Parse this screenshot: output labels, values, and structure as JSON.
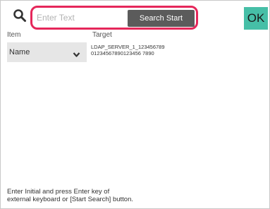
{
  "search": {
    "placeholder": "Enter Text",
    "value": "",
    "start_label": "Search Start"
  },
  "ok": {
    "label": "OK"
  },
  "columns": {
    "item": "Item",
    "target": "Target"
  },
  "item_select": {
    "selected": "Name"
  },
  "target": {
    "line1": "LDAP_SERVER_1_123456789",
    "line2": "01234567890123456 7890"
  },
  "hint": {
    "line1": "Enter Initial and press Enter key of",
    "line2": "external keyboard or [Start Search] button."
  },
  "colors": {
    "highlight": "#e5275a",
    "ok_button": "#46bfa7",
    "search_button": "#5b5b5b"
  },
  "icons": {
    "search": "search-icon",
    "dropdown": "chevron-down-icon"
  }
}
